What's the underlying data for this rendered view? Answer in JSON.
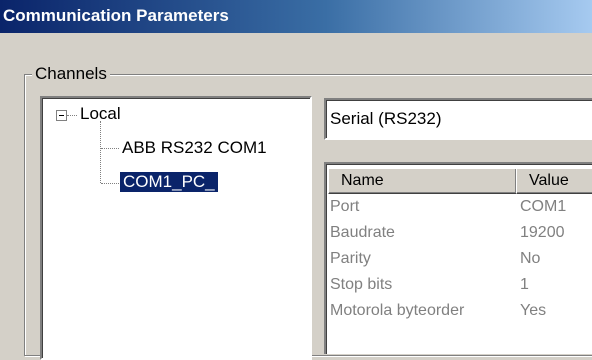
{
  "window": {
    "title": "Communication Parameters"
  },
  "channels": {
    "group_label": "Channels",
    "tree": {
      "root_label": "Local",
      "items": [
        {
          "label": "ABB RS232 COM1",
          "selected": false
        },
        {
          "label": "COM1_PC_",
          "selected": true
        }
      ]
    }
  },
  "details": {
    "connection_type": "Serial (RS232)",
    "columns": [
      "Name",
      "Value"
    ],
    "rows": [
      {
        "name": "Port",
        "value": "COM1"
      },
      {
        "name": "Baudrate",
        "value": "19200"
      },
      {
        "name": "Parity",
        "value": "No"
      },
      {
        "name": "Stop bits",
        "value": "1"
      },
      {
        "name": "Motorola byteorder",
        "value": "Yes"
      }
    ]
  },
  "colors": {
    "title_gradient_start": "#0a246a",
    "title_gradient_end": "#a6caf0",
    "selection": "#0a246a",
    "disabled_text": "#808080",
    "dialog_background": "#d4d0c8"
  }
}
